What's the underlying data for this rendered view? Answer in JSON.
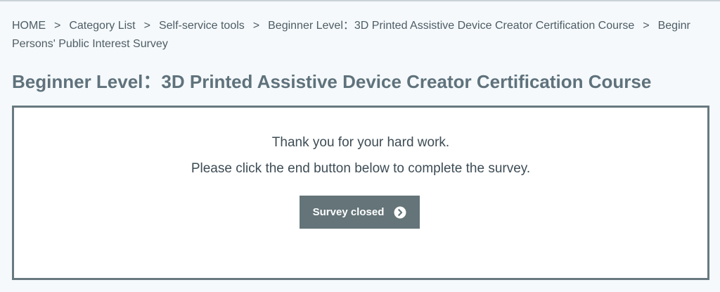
{
  "breadcrumb": {
    "items": [
      "HOME",
      "Category List",
      "Self-service tools",
      "Beginner Level：3D Printed Assistive Device Creator Certification Course",
      "Beginner Level：3D Printed Assistive Device Creator Certification Course Persons' Public Interest Survey"
    ],
    "last_line1": "Beginr",
    "last_line2": "Persons' Public Interest Survey",
    "separator": ">"
  },
  "page": {
    "title": "Beginner Level：3D Printed Assistive Device Creator Certification Course"
  },
  "panel": {
    "message_line1": "Thank you for your hard work.",
    "message_line2": "Please click the end button below to complete the survey.",
    "button_label": "Survey closed",
    "button_icon": "chevron-right-circle-icon"
  },
  "colors": {
    "title": "#5f727c",
    "panel_border": "#68797f",
    "button_bg": "#647479",
    "background": "#f5f9fb"
  }
}
